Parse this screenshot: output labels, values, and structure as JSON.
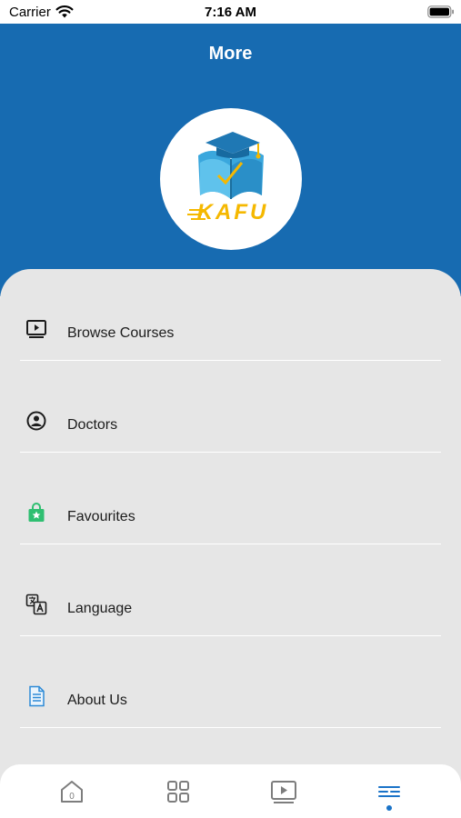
{
  "status_bar": {
    "carrier": "Carrier",
    "time": "7:16 AM"
  },
  "header": {
    "title": "More",
    "logo_text": "KAFU"
  },
  "menu": {
    "items": [
      {
        "label": "Browse Courses",
        "icon": "video-player-icon"
      },
      {
        "label": "Doctors",
        "icon": "user-circle-icon"
      },
      {
        "label": "Favourites",
        "icon": "shopping-bag-star-icon"
      },
      {
        "label": "Language",
        "icon": "translate-icon"
      },
      {
        "label": "About Us",
        "icon": "document-icon"
      }
    ]
  },
  "tabbar": {
    "tabs": [
      {
        "name": "home",
        "icon": "home-icon",
        "badge": "0",
        "active": false
      },
      {
        "name": "categories",
        "icon": "grid-icon",
        "active": false
      },
      {
        "name": "courses",
        "icon": "video-player-icon",
        "active": false
      },
      {
        "name": "more",
        "icon": "menu-lines-icon",
        "active": true
      }
    ]
  },
  "colors": {
    "header_background": "#176bb1",
    "panel_background": "#e6e6e6",
    "favourites_icon": "#2fbf71",
    "active_tab": "#1a73c8",
    "logo_text": "#f5b800"
  }
}
